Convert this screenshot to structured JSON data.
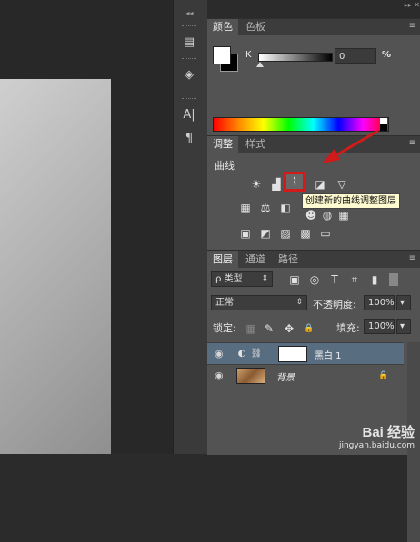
{
  "colors": {
    "accent_red": "#d21a1a",
    "selected_row": "#596d81",
    "panel_bg": "#535353"
  },
  "strip": {
    "collapse": "◂◂",
    "tools": [
      {
        "icon": "layer-comps-icon",
        "glyph": "▤"
      },
      {
        "icon": "3d-icon",
        "glyph": "◈"
      },
      {
        "icon": "character-icon",
        "glyph": "A|"
      },
      {
        "icon": "paragraph-icon",
        "glyph": "¶"
      }
    ]
  },
  "top_collapse": "▸▸  ✕",
  "color_panel": {
    "tabs": [
      "颜色",
      "色板"
    ],
    "channel_label": "K",
    "value": "0",
    "unit": "%",
    "menu": "≡"
  },
  "adjustments": {
    "tabs": [
      "调整",
      "样式"
    ],
    "title": "曲线",
    "tooltip": "创建新的曲线调整图层",
    "icons_row1": [
      "☀",
      "▟",
      "⌇",
      "◪",
      "▽"
    ],
    "icons_row2": [
      "▦",
      "⚖",
      "◧",
      "☻",
      "◍",
      "▦"
    ],
    "icons_row3": [
      "▣",
      "◩",
      "▨",
      "▩",
      "▭"
    ]
  },
  "layers_panel": {
    "tabs": [
      "图层",
      "通道",
      "路径"
    ],
    "filter_label": "ρ 类型",
    "filter_icons": [
      "▣",
      "◎",
      "T",
      "⌗",
      "▮"
    ],
    "blend_mode": "正常",
    "opacity_label": "不透明度:",
    "opacity_value": "100%",
    "lock_label": "锁定:",
    "lock_icons": [
      "▦",
      "✎",
      "✥",
      "🔒"
    ],
    "fill_label": "填充:",
    "fill_value": "100%",
    "layers": [
      {
        "name": "黑白 1",
        "visible": true,
        "selected": true
      },
      {
        "name": "背景",
        "visible": true,
        "selected": false,
        "locked": true
      }
    ]
  },
  "watermark": {
    "brand": "Bai 经验",
    "url": "jingyan.baidu.com"
  }
}
